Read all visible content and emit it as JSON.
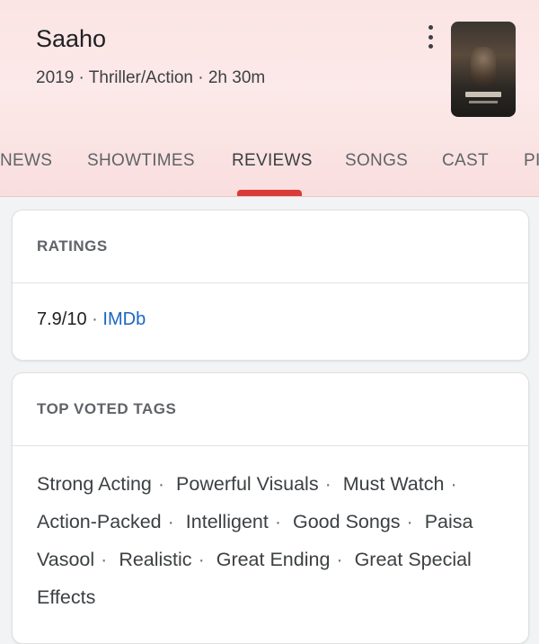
{
  "movie": {
    "title": "Saaho",
    "subtitle": "2019 · Thriller/Action · 2h 30m",
    "poster_icon": "movie-poster"
  },
  "tabs": [
    {
      "label": "NEWS",
      "active": false
    },
    {
      "label": "SHOWTIMES",
      "active": false
    },
    {
      "label": "REVIEWS",
      "active": true
    },
    {
      "label": "SONGS",
      "active": false
    },
    {
      "label": "CAST",
      "active": false
    },
    {
      "label": "PI",
      "active": false
    }
  ],
  "colors": {
    "accent": "#d93c38",
    "link": "#1a66c4",
    "header_bg": "#fbe4e4"
  },
  "ratings": {
    "heading": "RATINGS",
    "score": "7.9/10",
    "separator": "·",
    "source": "IMDb"
  },
  "tags": {
    "heading": "TOP VOTED TAGS",
    "items": [
      "Strong Acting",
      "Powerful Visuals",
      "Must Watch",
      "Action-Packed",
      "Intelligent",
      "Good Songs",
      "Paisa Vasool",
      "Realistic",
      "Great Ending",
      "Great Special Effects"
    ]
  }
}
